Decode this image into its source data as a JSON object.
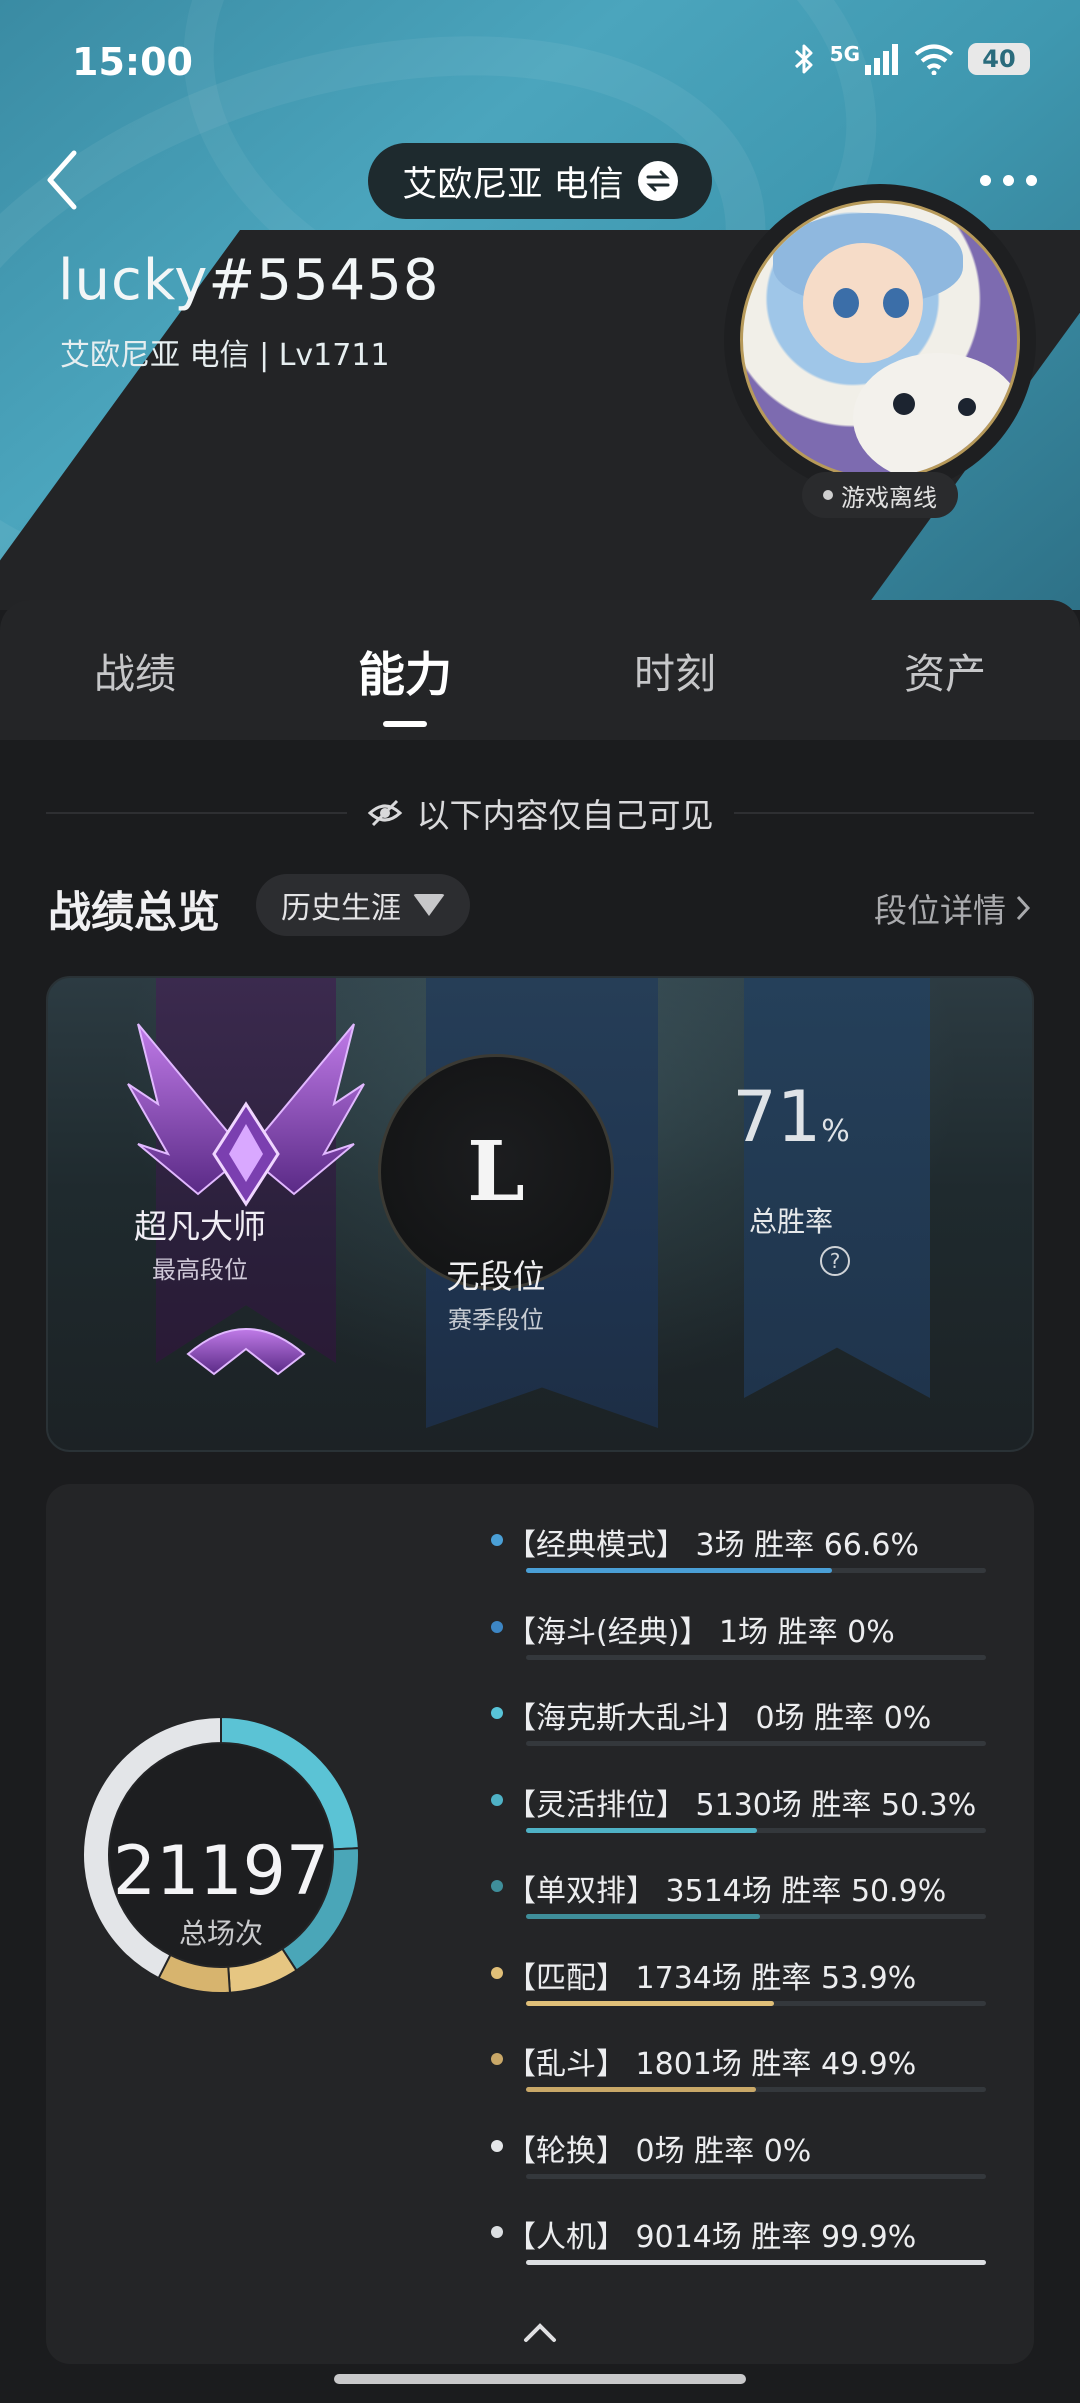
{
  "status_bar": {
    "time": "15:00",
    "network": "5G",
    "battery": "40",
    "icons": [
      "bluetooth-icon",
      "signal-icon",
      "wifi-icon",
      "battery-icon"
    ]
  },
  "header": {
    "server": "艾欧尼亚 电信",
    "username": "lucky#55458",
    "subinfo": "艾欧尼亚 电信 | Lv1711",
    "presence": "游戏离线"
  },
  "tabs": [
    {
      "label": "战绩",
      "active": false
    },
    {
      "label": "能力",
      "active": true
    },
    {
      "label": "时刻",
      "active": false
    },
    {
      "label": "资产",
      "active": false
    }
  ],
  "privacy_note": "以下内容仅自己可见",
  "overview": {
    "title": "战绩总览",
    "filter": "历史生涯",
    "detail_link": "段位详情"
  },
  "rank_card": {
    "highest": {
      "name": "超凡大师",
      "sub": "最高段位"
    },
    "season": {
      "emblem_letter": "L",
      "name": "无段位",
      "sub": "赛季段位"
    },
    "win_rate": {
      "value": "71",
      "unit": "%",
      "label": "总胜率"
    }
  },
  "stats": {
    "total": "21197",
    "total_label": "总场次",
    "modes": [
      {
        "text": "【经典模式】 3场  胜率 66.6%",
        "color": "#4a9fd6",
        "rate": 0.666
      },
      {
        "text": "【海斗(经典)】 1场  胜率 0%",
        "color": "#3d86c4",
        "rate": 0.0
      },
      {
        "text": "【海克斯大乱斗】 0场  胜率 0%",
        "color": "#58c4d8",
        "rate": 0.0
      },
      {
        "text": "【灵活排位】 5130场  胜率 50.3%",
        "color": "#4fb2c6",
        "rate": 0.503
      },
      {
        "text": "【单双排】 3514场  胜率 50.9%",
        "color": "#3f8e9a",
        "rate": 0.509
      },
      {
        "text": "【匹配】 1734场  胜率 53.9%",
        "color": "#e0bf78",
        "rate": 0.539
      },
      {
        "text": "【乱斗】 1801场  胜率 49.9%",
        "color": "#c9a868",
        "rate": 0.499
      },
      {
        "text": "【轮换】 0场  胜率 0%",
        "color": "#e4e6e8",
        "rate": 0.0
      },
      {
        "text": "【人机】 9014场  胜率 99.9%",
        "color": "#dcdfe2",
        "rate": 0.999
      }
    ],
    "donut_segments": [
      {
        "name": "灵活排位",
        "games": 5130,
        "color": "#5bc3d5"
      },
      {
        "name": "单双排",
        "games": 3514,
        "color": "#4aa6b8"
      },
      {
        "name": "匹配",
        "games": 1734,
        "color": "#e6c682"
      },
      {
        "name": "乱斗",
        "games": 1801,
        "color": "#d7b46e"
      },
      {
        "name": "人机",
        "games": 9014,
        "color": "#e3e5e8"
      }
    ]
  }
}
